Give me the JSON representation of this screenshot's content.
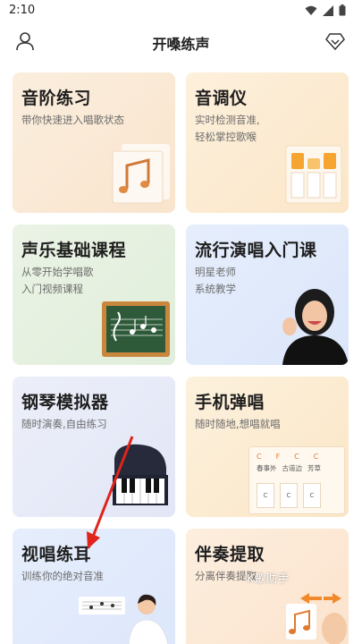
{
  "status_bar": {
    "time": "2:10"
  },
  "header": {
    "title": "开嗓练声"
  },
  "cards": [
    {
      "title": "音阶练习",
      "sub_lines": [
        "带你快速进入唱歌状态"
      ]
    },
    {
      "title": "音调仪",
      "sub_lines": [
        "实时检测音准,",
        "轻松掌控歌喉"
      ]
    },
    {
      "title": "声乐基础课程",
      "sub_lines": [
        "从零开始学唱歌",
        "入门视频课程"
      ]
    },
    {
      "title": "流行演唱入门课",
      "sub_lines": [
        "明星老师",
        "系统教学"
      ]
    },
    {
      "title": "钢琴模拟器",
      "sub_lines": [
        "随时演奏,自由练习"
      ]
    },
    {
      "title": "手机弹唱",
      "sub_lines": [
        "随时随地,想唱就唱"
      ]
    },
    {
      "title": "视唱练耳",
      "sub_lines": [
        "训练你的绝对音准"
      ]
    },
    {
      "title": "伴奏提取",
      "sub_lines": [
        "分离伴奏提取"
      ]
    }
  ],
  "chord_chart": {
    "chords_top": [
      "C",
      "F",
      "C",
      "C"
    ],
    "lyrics": [
      "春事外",
      "古道边",
      "芳草"
    ],
    "keys": [
      "C",
      "C",
      "C"
    ]
  },
  "watermark": "K歌助手",
  "colors": {
    "accent_arrow": "#e0241b"
  }
}
